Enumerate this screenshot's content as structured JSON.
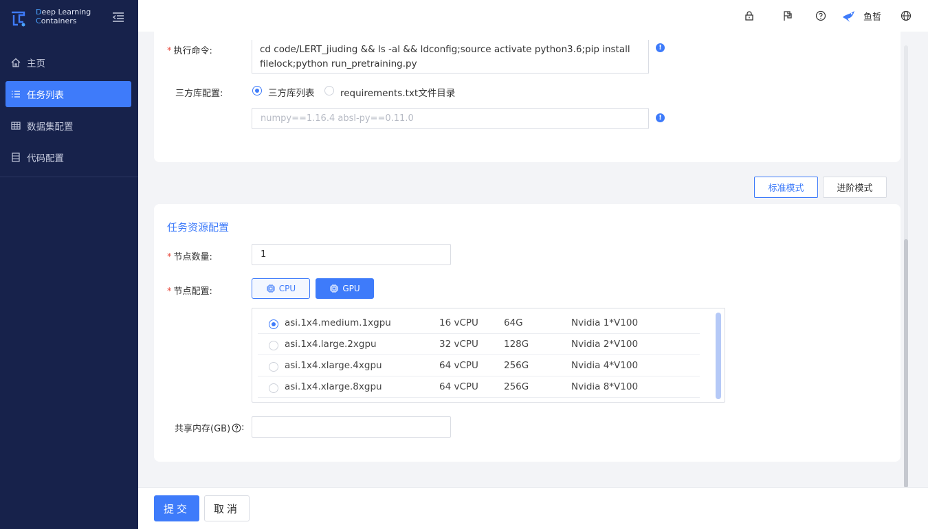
{
  "brand": {
    "line1_first": "D",
    "line1_rest": "eep Learning",
    "line2_first": "C",
    "line2_rest": "ontainers"
  },
  "sidebar": {
    "items": [
      {
        "label": "主页",
        "icon": "home-icon"
      },
      {
        "label": "任务列表",
        "icon": "list-icon",
        "active": true
      },
      {
        "label": "数据集配置",
        "icon": "table-icon"
      },
      {
        "label": "代码配置",
        "icon": "file-icon"
      }
    ]
  },
  "topbar": {
    "user_name": "鱼哲"
  },
  "form": {
    "command_label": "执行命令:",
    "command_line1": "cd code/LERT_jiuding && ls -al && ldconfig;source activate python3.6;pip install",
    "command_line2": "filelock;python run_pretraining.py",
    "lib_label": "三方库配置:",
    "lib_option1": "三方库列表",
    "lib_option2": "requirements.txt文件目录",
    "lib_placeholder": "numpy==1.16.4   absl-py==0.11.0"
  },
  "modes": {
    "standard": "标准模式",
    "advanced": "进阶模式"
  },
  "resources": {
    "title": "任务资源配置",
    "node_count_label": "节点数量:",
    "node_count_value": "1",
    "node_config_label": "节点配置:",
    "cpu_label": "CPU",
    "gpu_label": "GPU",
    "specs": [
      {
        "name": "asi.1x4.medium.1xgpu",
        "cpu": "16 vCPU",
        "mem": "64G",
        "gpu": "Nvidia 1*V100",
        "selected": true
      },
      {
        "name": "asi.1x4.large.2xgpu",
        "cpu": "32 vCPU",
        "mem": "128G",
        "gpu": "Nvidia 2*V100"
      },
      {
        "name": "asi.1x4.xlarge.4xgpu",
        "cpu": "64 vCPU",
        "mem": "256G",
        "gpu": "Nvidia 4*V100"
      },
      {
        "name": "asi.1x4.xlarge.8xgpu",
        "cpu": "64 vCPU",
        "mem": "256G",
        "gpu": "Nvidia 8*V100"
      }
    ],
    "shm_label": "共享内存(GB)",
    "shm_colon": ":"
  },
  "footer": {
    "submit": "提交",
    "cancel": "取消"
  },
  "colors": {
    "accent": "#3e7bfa",
    "sidebar_bg": "#17224b",
    "required": "#e8483b"
  }
}
